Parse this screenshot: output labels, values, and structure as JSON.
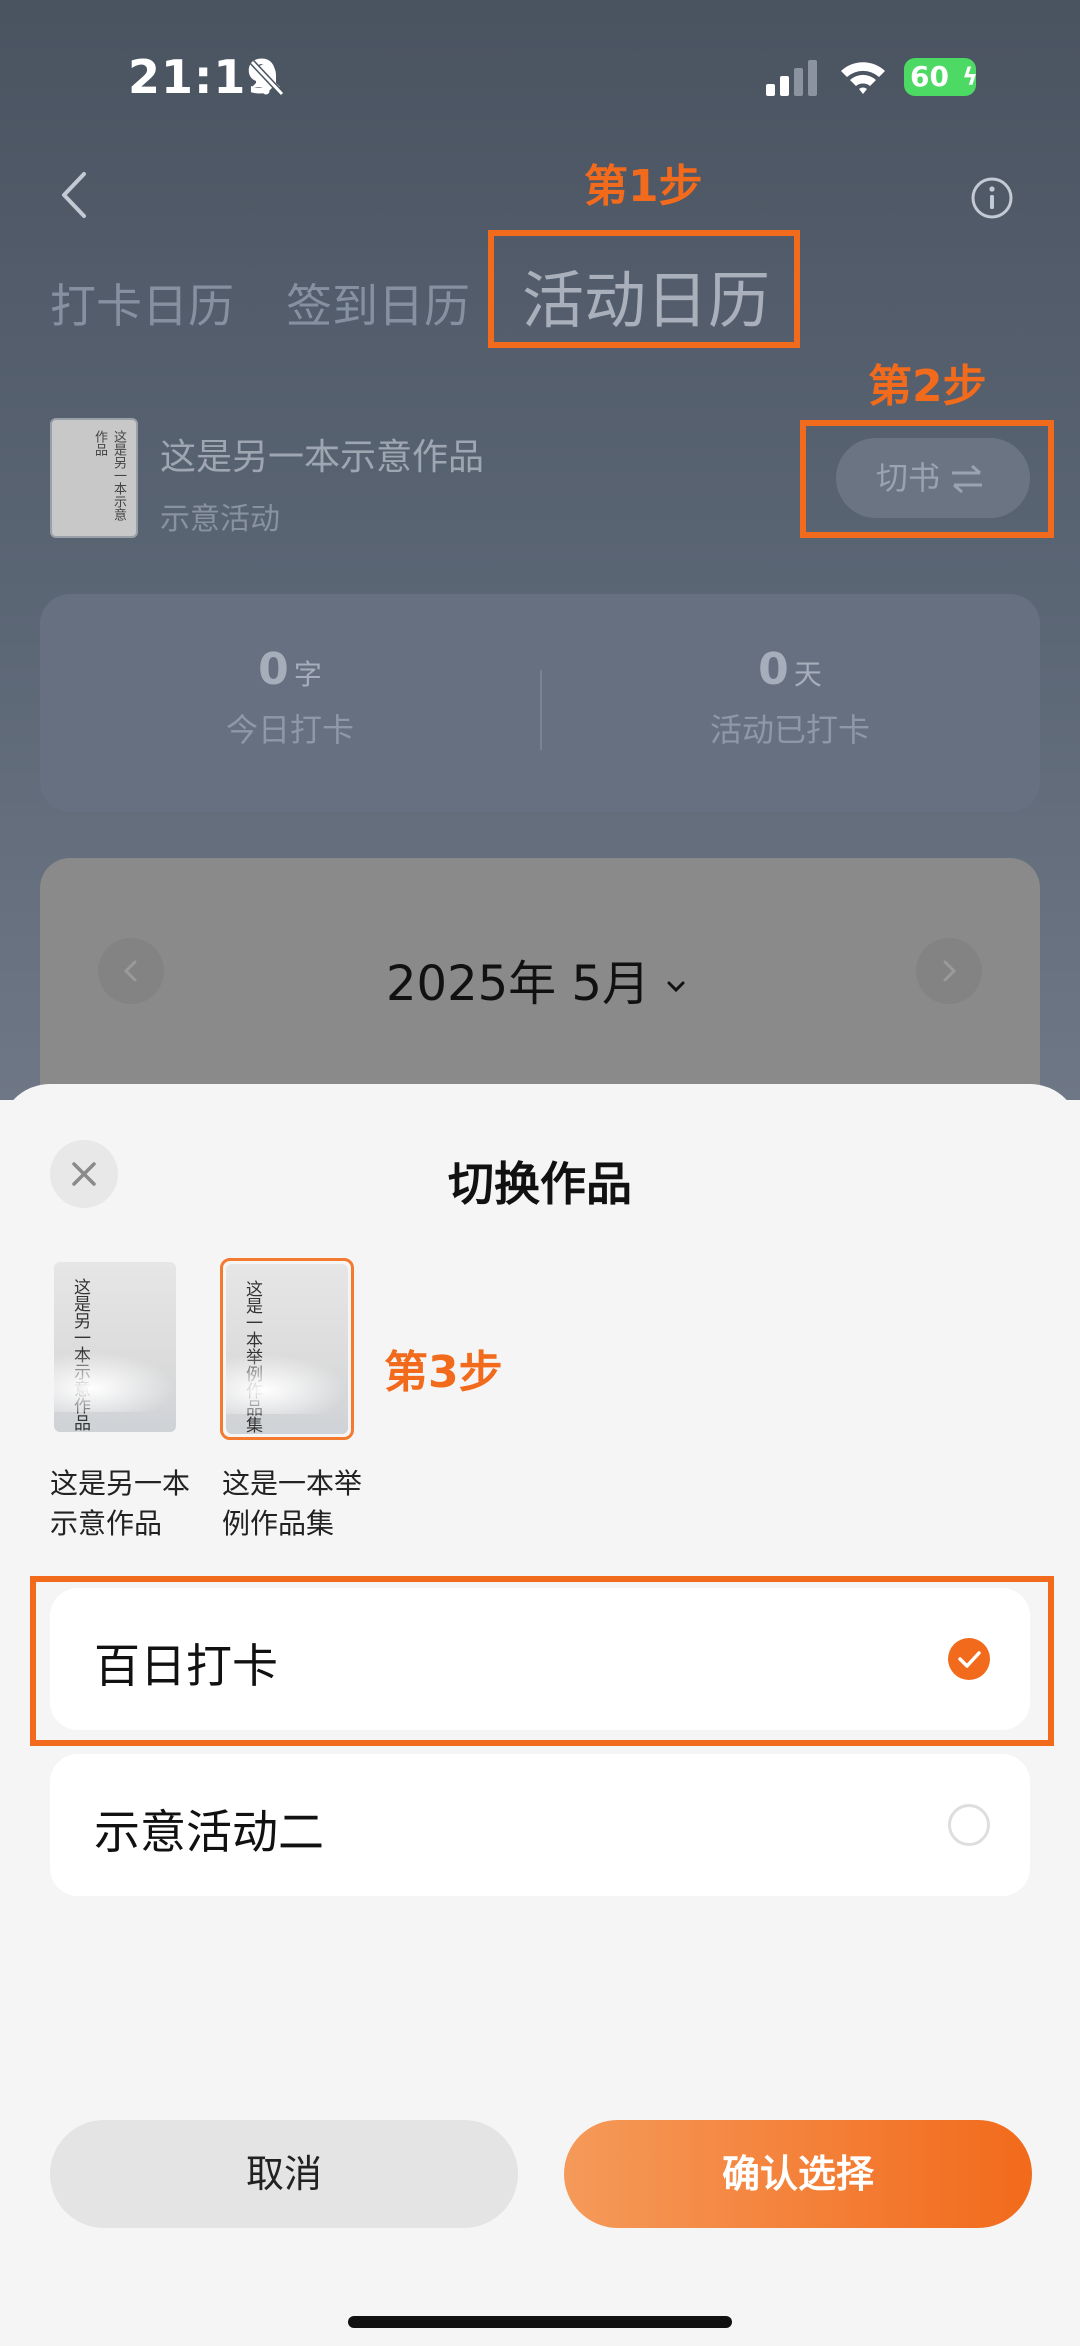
{
  "status_bar": {
    "time": "21:19",
    "battery": "60"
  },
  "tabs": [
    {
      "label": "打卡日历"
    },
    {
      "label": "签到日历"
    },
    {
      "label": "活动日历"
    }
  ],
  "current_book": {
    "title": "这是另一本示意作品",
    "activity": "示意活动",
    "switch_label": "切书"
  },
  "stats": [
    {
      "value": "0",
      "unit": "字",
      "label": "今日打卡"
    },
    {
      "value": "0",
      "unit": "天",
      "label": "活动已打卡"
    }
  ],
  "calendar": {
    "month_label": "2025年 5月"
  },
  "sheet": {
    "title": "切换作品",
    "books": [
      {
        "cover_text": "这是另一本示意作品",
        "caption": "这是另一本示意作品",
        "selected": false
      },
      {
        "cover_text": "这是一本举例作品集",
        "caption": "这是一本举例作品集",
        "selected": true
      }
    ],
    "activities": [
      {
        "label": "百日打卡",
        "checked": true
      },
      {
        "label": "示意活动二",
        "checked": false
      }
    ],
    "cancel_label": "取消",
    "confirm_label": "确认选择"
  },
  "annotations": {
    "step1": "第1步",
    "step2": "第2步",
    "step3": "第3步"
  },
  "colors": {
    "accent": "#f26a1b",
    "battery": "#4cd964"
  }
}
